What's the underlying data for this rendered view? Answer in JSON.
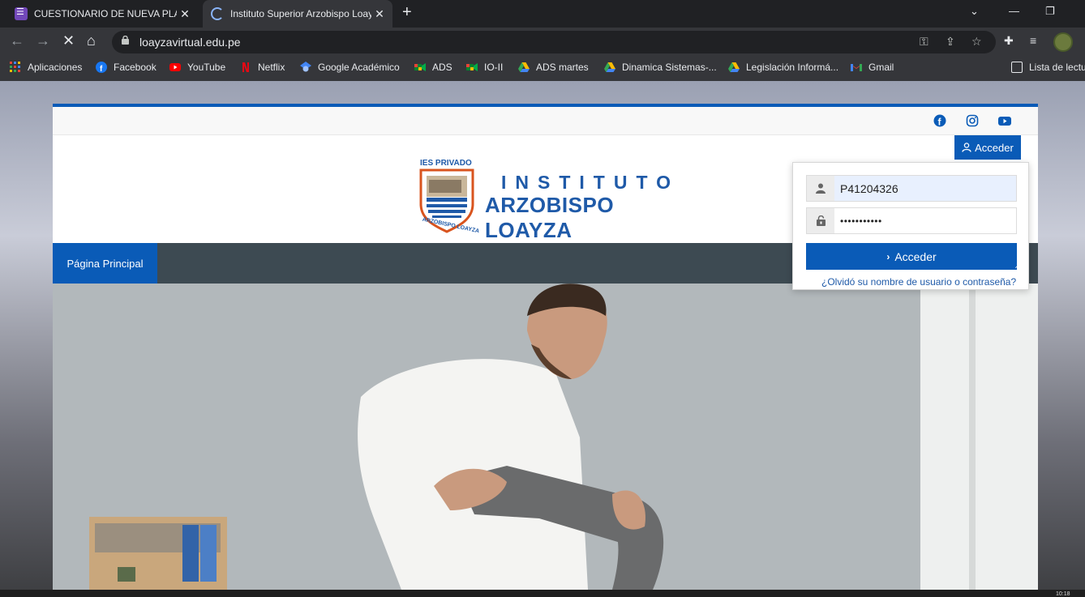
{
  "browser": {
    "tabs": [
      {
        "title": "CUESTIONARIO DE NUEVA PLATA",
        "active": false
      },
      {
        "title": "Instituto Superior Arzobispo Loay",
        "active": true
      }
    ],
    "url": "loayzavirtual.edu.pe",
    "bookmarks": [
      {
        "label": "Aplicaciones",
        "icon": "apps-grid-icon"
      },
      {
        "label": "Facebook",
        "icon": "facebook-icon"
      },
      {
        "label": "YouTube",
        "icon": "youtube-icon"
      },
      {
        "label": "Netflix",
        "icon": "netflix-icon"
      },
      {
        "label": "Google Académico",
        "icon": "scholar-icon"
      },
      {
        "label": "ADS",
        "icon": "meet-icon"
      },
      {
        "label": "IO-II",
        "icon": "meet-icon"
      },
      {
        "label": "ADS martes",
        "icon": "drive-icon"
      },
      {
        "label": "Dinamica Sistemas-...",
        "icon": "drive-icon"
      },
      {
        "label": "Legislación Informá...",
        "icon": "drive-icon"
      },
      {
        "label": "Gmail",
        "icon": "gmail-icon"
      }
    ],
    "reading_list": "Lista de lectu"
  },
  "site": {
    "logo": {
      "ies": "IES PRIVADO",
      "line1": "INSTITUTO",
      "line2": "ARZOBISPO LOAYZA",
      "seal_text": "ARZOBISPO LOAYZA"
    },
    "acceder_label": "Acceder",
    "nav_home": "Página Principal",
    "login": {
      "username": "P41204326",
      "password_mask": "•••••••••••",
      "submit_label": "Acceder",
      "forgot_link": "¿Olvidó su nombre de usuario o contraseña?"
    }
  },
  "taskbar": {
    "clock": "10:18"
  },
  "colors": {
    "brand_blue": "#0a5bb7",
    "nav_dark": "#3d4a52",
    "chrome_dark": "#202124",
    "chrome_mid": "#35363a"
  }
}
